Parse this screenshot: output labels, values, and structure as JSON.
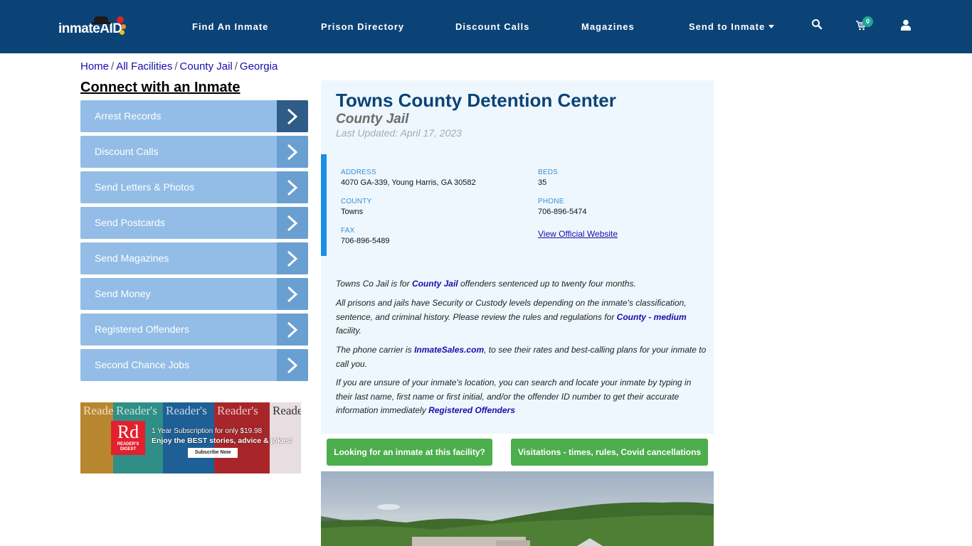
{
  "header": {
    "logo_text": "inmateAID",
    "nav": [
      {
        "label": "Find An Inmate"
      },
      {
        "label": "Prison Directory"
      },
      {
        "label": "Discount Calls"
      },
      {
        "label": "Magazines"
      },
      {
        "label": "Send to Inmate",
        "has_dropdown": true
      }
    ],
    "icons": [
      "search-icon",
      "cart-icon",
      "user-icon"
    ],
    "cart_count": "0"
  },
  "breadcrumb": [
    {
      "label": "Home"
    },
    {
      "label": "All Facilities"
    },
    {
      "label": "County Jail"
    },
    {
      "label": "Georgia"
    }
  ],
  "sidebar": {
    "heading": "Connect with an Inmate",
    "items": [
      {
        "label": "Arrest Records",
        "active": true
      },
      {
        "label": "Discount Calls"
      },
      {
        "label": "Send Letters & Photos"
      },
      {
        "label": "Send Postcards"
      },
      {
        "label": "Send Magazines"
      },
      {
        "label": "Send Money"
      },
      {
        "label": "Registered Offenders"
      },
      {
        "label": "Second Chance Jobs"
      }
    ],
    "ad": {
      "brand": "Rd",
      "brand_sub": "READER'S DIGEST",
      "cover_title": "Reader's",
      "line1": "1 Year Subscription for only $19.98",
      "line2": "Enjoy the BEST stories, advice & jokes!",
      "button": "Subscribe Now"
    }
  },
  "facility": {
    "title": "Towns County Detention Center",
    "type": "County Jail",
    "last_updated": "Last Updated: April 17, 2023",
    "info": {
      "address_label": "ADDRESS",
      "address": "4070 GA-339, Young Harris, GA 30582",
      "beds_label": "BEDS",
      "beds": "35",
      "county_label": "COUNTY",
      "county": "Towns",
      "phone_label": "PHONE",
      "phone": "706-896-5474",
      "fax_label": "FAX",
      "fax": "706-896-5489",
      "website_link": "View Official Website"
    },
    "description": {
      "p1_pre": "Towns Co Jail is for ",
      "p1_link": "County Jail",
      "p1_post": " offenders sentenced up to twenty four months.",
      "p2_pre": "All prisons and jails have Security or Custody levels depending on the inmate's classification, sentence, and criminal history. Please review the rules and regulations for ",
      "p2_link": "County - medium",
      "p2_post": " facility.",
      "p3_pre": "The phone carrier is ",
      "p3_link": "InmateSales.com",
      "p3_post": ", to see their rates and best-calling plans for your inmate to call you.",
      "p4_pre": "If you are unsure of your inmate's location, you can search and locate your inmate by typing in their last name, first name or first initial, and/or the offender ID number to get their accurate information immediately ",
      "p4_link": "Registered Offenders"
    },
    "buttons": {
      "find_inmate": "Looking for an inmate at this facility?",
      "visitations": "Visitations - times, rules, Covid cancellations"
    }
  }
}
